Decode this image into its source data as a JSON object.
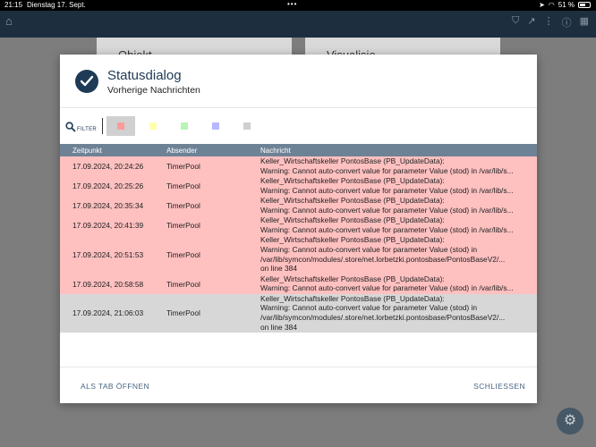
{
  "statusbar": {
    "time": "21:15",
    "date": "Dienstag 17. Sept.",
    "dots": "•••",
    "battery": "51 %"
  },
  "background": {
    "tile1": "Objekt",
    "tile2": "Visualisie"
  },
  "dialog": {
    "title": "Statusdialog",
    "subtitle": "Vorherige Nachrichten",
    "filter_label": "FILTER",
    "filter_chips": [
      {
        "color": "#ff9a9a"
      },
      {
        "color": "#ffffb0"
      },
      {
        "color": "#b6f5b6"
      },
      {
        "color": "#b8b8ff"
      },
      {
        "color": "#cfcfcf"
      }
    ],
    "columns": [
      "Zeitpunkt",
      "Absender",
      "Nachricht"
    ],
    "rows": [
      {
        "time": "17.09.2024, 20:24:26",
        "sender": "TimerPool",
        "lines": [
          "Keller_Wirtschaftskeller PontosBase (PB_UpdateData):",
          "Warning: Cannot auto-convert value for parameter Value (stod) in /var/lib/s..."
        ],
        "level": "red"
      },
      {
        "time": "17.09.2024, 20:25:26",
        "sender": "TimerPool",
        "lines": [
          "Keller_Wirtschaftskeller PontosBase (PB_UpdateData):",
          "Warning: Cannot auto-convert value for parameter Value (stod) in /var/lib/s..."
        ],
        "level": "red"
      },
      {
        "time": "17.09.2024, 20:35:34",
        "sender": "TimerPool",
        "lines": [
          "Keller_Wirtschaftskeller PontosBase (PB_UpdateData):",
          "Warning: Cannot auto-convert value for parameter Value (stod) in /var/lib/s..."
        ],
        "level": "red"
      },
      {
        "time": "17.09.2024, 20:41:39",
        "sender": "TimerPool",
        "lines": [
          "Keller_Wirtschaftskeller PontosBase (PB_UpdateData):",
          "Warning: Cannot auto-convert value for parameter Value (stod) in /var/lib/s..."
        ],
        "level": "red"
      },
      {
        "time": "17.09.2024, 20:51:53",
        "sender": "TimerPool",
        "lines": [
          "Keller_Wirtschaftskeller PontosBase (PB_UpdateData):",
          "Warning: Cannot auto-convert value for parameter Value (stod) in",
          "/var/lib/symcon/modules/.store/net.lorbetzki.pontosbase/PontosBaseV2/...",
          "on line 384"
        ],
        "level": "red"
      },
      {
        "time": "17.09.2024, 20:58:58",
        "sender": "TimerPool",
        "lines": [
          "Keller_Wirtschaftskeller PontosBase (PB_UpdateData):",
          "Warning: Cannot auto-convert value for parameter Value (stod) in /var/lib/s..."
        ],
        "level": "red"
      },
      {
        "time": "17.09.2024, 21:06:03",
        "sender": "TimerPool",
        "lines": [
          "Keller_Wirtschaftskeller PontosBase (PB_UpdateData):",
          "Warning: Cannot auto-convert value for parameter Value (stod) in",
          "/var/lib/symcon/modules/.store/net.lorbetzki.pontosbase/PontosBaseV2/...",
          "on line 384"
        ],
        "level": "gray"
      }
    ],
    "open_as_tab": "ALS TAB ÖFFNEN",
    "close": "SCHLIESSEN"
  }
}
